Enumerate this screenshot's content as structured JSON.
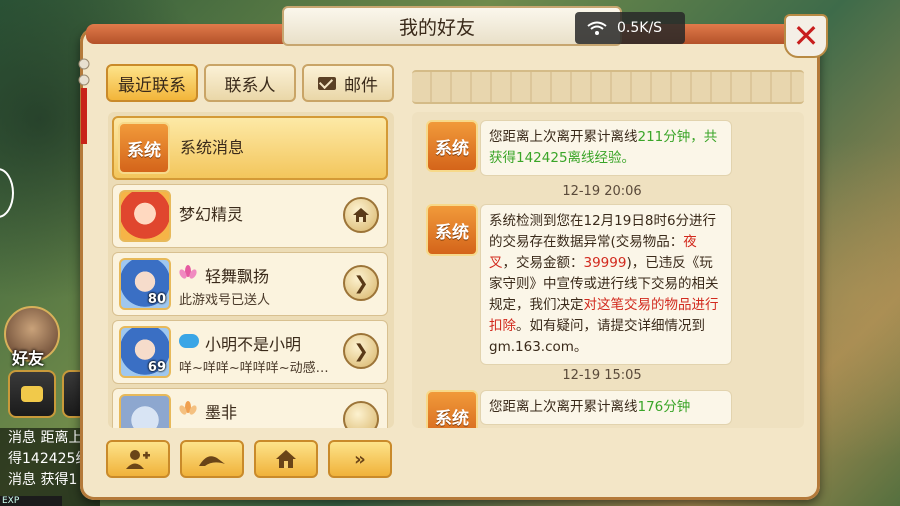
{
  "title": "我的好友",
  "network": {
    "speed": "0.5K/S"
  },
  "tabs": [
    {
      "label": "最近联系",
      "active": true
    },
    {
      "label": "联系人",
      "active": false
    },
    {
      "label": "邮件",
      "active": false
    }
  ],
  "contacts": [
    {
      "badge": "系统",
      "name": "系统消息"
    },
    {
      "name": "梦幻精灵"
    },
    {
      "name": "轻舞飘扬",
      "level": "80",
      "subtitle": "此游戏号已送人"
    },
    {
      "name": "小明不是小明",
      "level": "69",
      "subtitle": "咩~咩咩~咩咩咩~动感…"
    },
    {
      "name": "墨非"
    }
  ],
  "messages": [
    {
      "badge": "系统",
      "segments": [
        {
          "text": "您距离上次离开累计离线",
          "color": "normal"
        },
        {
          "text": "211分钟，共获得142425离线经验。",
          "color": "green"
        }
      ]
    },
    {
      "time": "12-19 20:06"
    },
    {
      "badge": "系统",
      "segments": [
        {
          "text": "系统检测到您在12月19日8时6分进行的交易存在数据异常(交易物品：",
          "color": "normal"
        },
        {
          "text": "夜叉",
          "color": "red"
        },
        {
          "text": "，交易金额：",
          "color": "normal"
        },
        {
          "text": "39999",
          "color": "red"
        },
        {
          "text": ")，已违反《玩家守则》中宣传或进行线下交易的相关规定，我们决定",
          "color": "normal"
        },
        {
          "text": "对这笔交易的物品进行扣除",
          "color": "red"
        },
        {
          "text": "。如有疑问，请提交详细情况到gm.163.com。",
          "color": "normal"
        }
      ]
    },
    {
      "time": "12-19 15:05"
    },
    {
      "badge": "系统",
      "segments": [
        {
          "text": "您距离上次离开累计离线",
          "color": "normal"
        },
        {
          "text": "176分钟",
          "color": "green"
        }
      ]
    }
  ],
  "hud": {
    "friend_label": "好友",
    "messages": [
      "消息 距离上",
      "得142425经",
      "消息 获得1"
    ],
    "exp_label": "EXP"
  },
  "colors": {
    "accent": "#f2b53a",
    "green_text": "#3aa528",
    "red_text": "#d22a1e",
    "close": "#c81e1e"
  }
}
